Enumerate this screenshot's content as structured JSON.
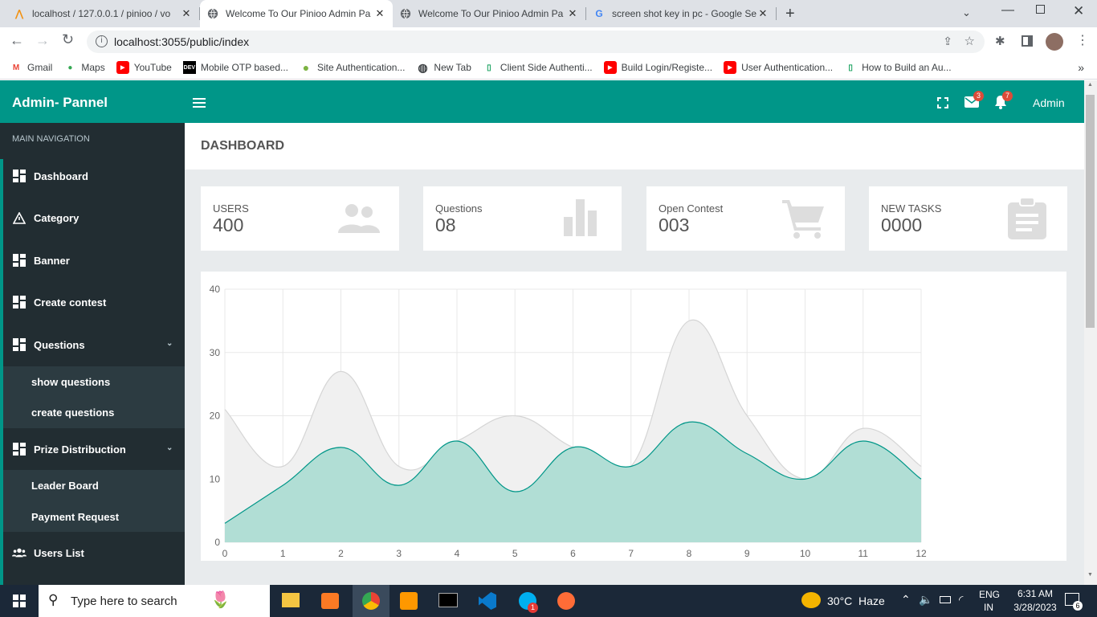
{
  "browser": {
    "tabs": [
      {
        "title": "localhost / 127.0.0.1 / pinioo / vo",
        "favicon": "phpmyadmin-icon"
      },
      {
        "title": "Welcome To Our Pinioo Admin Pa",
        "favicon": "globe-icon"
      },
      {
        "title": "Welcome To Our Pinioo Admin Pa",
        "favicon": "globe-icon"
      },
      {
        "title": "screen shot key in pc - Google Se",
        "favicon": "google-icon"
      }
    ],
    "active_tab": 1,
    "url": "localhost:3055/public/index",
    "bookmarks": [
      {
        "label": "Gmail",
        "icon": "gmail-icon"
      },
      {
        "label": "Maps",
        "icon": "maps-icon"
      },
      {
        "label": "YouTube",
        "icon": "youtube-icon"
      },
      {
        "label": "Mobile OTP based...",
        "icon": "dev-icon"
      },
      {
        "label": "Site Authentication...",
        "icon": "leaf-icon"
      },
      {
        "label": "New Tab",
        "icon": "globe-icon"
      },
      {
        "label": "Client Side Authenti...",
        "icon": "doc-icon"
      },
      {
        "label": "Build Login/Registe...",
        "icon": "youtube-icon"
      },
      {
        "label": "User Authentication...",
        "icon": "youtube-icon"
      },
      {
        "label": "How to Build an Au...",
        "icon": "doc-icon"
      }
    ],
    "more_label": "»"
  },
  "app": {
    "brand": "Admin- Pannel",
    "mail_count": "3",
    "notif_count": "7",
    "user": "Admin",
    "accent": "#009688"
  },
  "sidebar": {
    "heading": "MAIN NAVIGATION",
    "items": [
      {
        "label": "Dashboard",
        "icon": "grid-icon"
      },
      {
        "label": "Category",
        "icon": "warning-icon"
      },
      {
        "label": "Banner",
        "icon": "grid-icon"
      },
      {
        "label": "Create contest",
        "icon": "grid-icon"
      },
      {
        "label": "Questions",
        "icon": "grid-icon"
      },
      {
        "label": "Prize Distribuction",
        "icon": "grid-icon"
      },
      {
        "label": "Users List",
        "icon": "users-icon"
      }
    ],
    "questions_sub": [
      "show questions",
      "create questions"
    ],
    "prize_sub": [
      "Leader Board",
      "Payment Request"
    ]
  },
  "page": {
    "title": "DASHBOARD"
  },
  "cards": [
    {
      "label": "USERS",
      "value": "400",
      "icon": "users-icon"
    },
    {
      "label": "Questions",
      "value": "08",
      "icon": "bar-chart-icon"
    },
    {
      "label": "Open Contest",
      "value": "003",
      "icon": "cart-icon"
    },
    {
      "label": "NEW TASKS",
      "value": "0000",
      "icon": "clipboard-icon"
    }
  ],
  "chart_data": {
    "type": "area",
    "x": [
      0,
      1,
      2,
      3,
      4,
      5,
      6,
      7,
      8,
      9,
      10,
      11,
      12
    ],
    "series": [
      {
        "values": [
          21,
          12,
          27,
          12,
          16,
          20,
          15,
          12,
          35,
          20,
          10,
          18,
          12
        ],
        "color": "#dddddd"
      },
      {
        "values": [
          3,
          9,
          15,
          9,
          16,
          8,
          15,
          12,
          19,
          14,
          10,
          16,
          10
        ],
        "color": "#009688"
      }
    ],
    "ylim": [
      0,
      40
    ],
    "yticks": [
      0,
      10,
      20,
      30,
      40
    ],
    "grid": true
  },
  "taskbar": {
    "search_placeholder": "Type here to search",
    "weather": "30°C  Haze",
    "lang1": "ENG",
    "lang2": "IN",
    "time": "6:31 AM",
    "date": "3/28/2023",
    "notif_count": "6",
    "skype_badge": "1"
  }
}
